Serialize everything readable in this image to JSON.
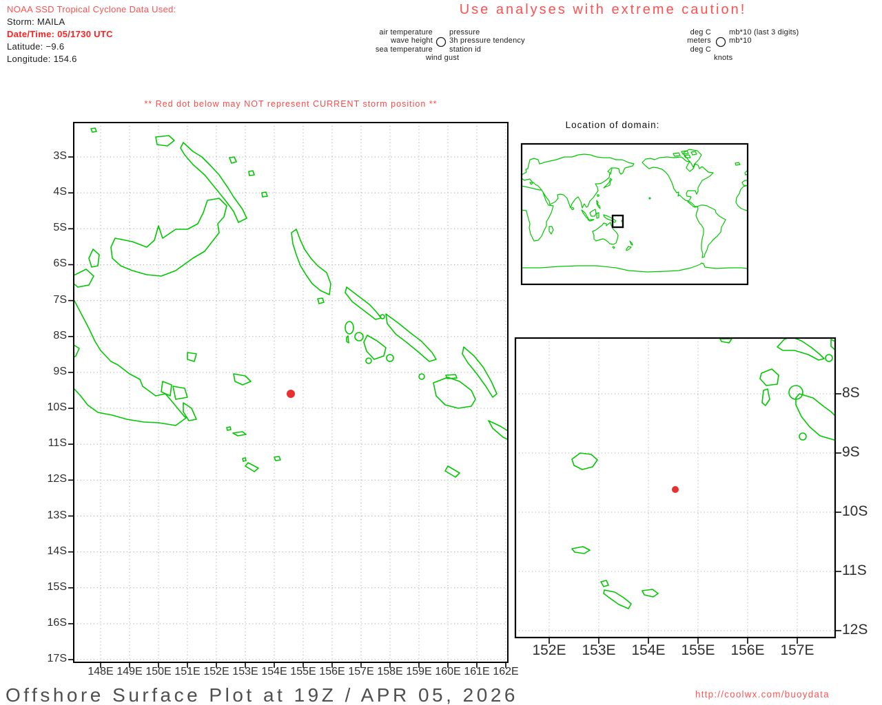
{
  "header": {
    "source_line": "NOAA SSD Tropical Cyclone Data Used:",
    "storm": "Storm: MAILA",
    "datetime": "Date/Time: 05/1730 UTC",
    "latitude": "Latitude: −9.6",
    "longitude": "Longitude: 154.6"
  },
  "caution_title": "Use analyses with extreme caution!",
  "station_legend": {
    "row1_left": "air temperature",
    "row2_left": "wave height",
    "row3_left": "sea temperature",
    "row4": "wind gust",
    "row1_right": "pressure",
    "row2_right": "3h pressure tendency",
    "row3_right": "station id"
  },
  "units_legend": {
    "row1_left": "deg C",
    "row2_left": "meters",
    "row3_left": "deg C",
    "row4": "knots",
    "row1_right": "mb*10 (last 3 digits)",
    "row2_right": "mb*10"
  },
  "storm_warning": "** Red dot below may NOT represent CURRENT storm position **",
  "world_inset": {
    "title": "Location of domain:"
  },
  "main_map": {
    "x_labels": [
      "148E",
      "149E",
      "150E",
      "151E",
      "152E",
      "153E",
      "154E",
      "155E",
      "156E",
      "157E",
      "158E",
      "159E",
      "160E",
      "161E",
      "162E"
    ],
    "y_labels": [
      "3S",
      "4S",
      "5S",
      "6S",
      "7S",
      "8S",
      "9S",
      "10S",
      "11S",
      "12S",
      "13S",
      "14S",
      "15S",
      "16S",
      "17S"
    ],
    "storm_dot": {
      "lon": "154.6E",
      "lat": "9.6S"
    }
  },
  "zoom_map": {
    "x_labels": [
      "152E",
      "153E",
      "154E",
      "155E",
      "156E",
      "157E"
    ],
    "y_labels": [
      "8S",
      "9S",
      "10S",
      "11S",
      "12S"
    ]
  },
  "footer": {
    "title": "Offshore Surface Plot at 19Z / APR 05, 2026",
    "url": "http://coolwx.com/buoydata"
  },
  "colors": {
    "coast_green": "#00c800",
    "warning_red": "#ff5050",
    "dot_red": "#e83030",
    "grid_gray": "#a8a8a8",
    "frame_black": "#000000"
  }
}
